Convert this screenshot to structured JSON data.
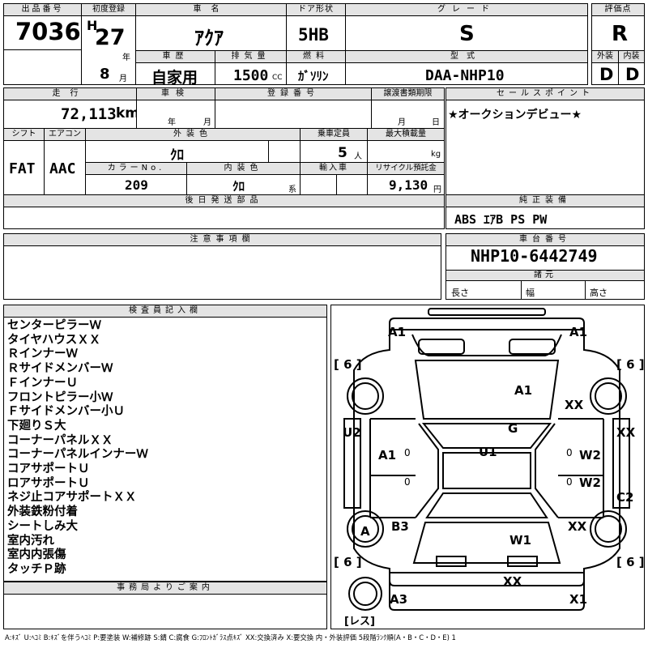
{
  "header": {
    "lot_label": "出品番号",
    "lot_number": "7036",
    "first_reg_label": "初度登録",
    "era": "H",
    "year": "27",
    "year_unit": "年",
    "month": "8",
    "month_unit": "月",
    "name_label": "車名",
    "car_name": "ｱｸｱ",
    "door_label": "ドア形状",
    "door_type": "5HB",
    "grade_label": "グレード",
    "grade": "S",
    "score_label": "評価点",
    "score": "R",
    "history_label": "車歴",
    "history": "自家用",
    "displacement_label": "排気量",
    "displacement": "1500",
    "displacement_unit": "CC",
    "fuel_label": "燃料",
    "fuel": "ｶﾞｿﾘﾝ",
    "model_label": "型式",
    "model": "DAA-NHP10",
    "exterior_label": "外装",
    "exterior_grade": "D",
    "interior_label": "内装",
    "interior_grade": "D"
  },
  "row2": {
    "mileage_label": "走行",
    "mileage": "72,113",
    "mileage_unit": "km",
    "inspection_label": "車検",
    "insp_year_unit": "年",
    "insp_month_unit": "月",
    "plate_label": "登録番号",
    "transfer_label": "譲渡書類期限",
    "transfer_month_unit": "月",
    "transfer_day_unit": "日",
    "shift_label": "シフト",
    "shift": "FAT",
    "ac_label": "エアコン",
    "ac": "AAC",
    "ext_color_label": "外装色",
    "ext_color": "ｸﾛ",
    "capacity_label": "乗車定員",
    "capacity": "5",
    "capacity_unit": "人",
    "load_label": "最大積載量",
    "load_unit": "kg",
    "color_no_label": "カラーNo.",
    "color_no": "209",
    "int_color_label": "内装色",
    "int_color": "ｸﾛ",
    "int_color_unit": "系",
    "import_label": "輸入車",
    "recycle_label": "リサイクル預託金",
    "recycle": "9,130",
    "recycle_unit": "円",
    "sales_point_label": "セールスポイント",
    "sales_point": "★オークションデビュー★",
    "later_parts_label": "後日発送部品",
    "equipment_label": "純正装備",
    "equipment": "ABS ｴｱB PS PW"
  },
  "notes": {
    "caution_label": "注意事項欄",
    "chassis_label": "車台番号",
    "chassis": "NHP10-6442749",
    "spec_label": "諸元",
    "length_label": "長さ",
    "width_label": "幅",
    "height_label": "高さ"
  },
  "inspector": {
    "label": "検査員記入欄",
    "items": [
      "センターピラーＷ",
      "タイヤハウスＸＸ",
      "ＲインナーＷ",
      "ＲサイドメンバーＷ",
      "ＦインナーＵ",
      "フロントピラー小Ｗ",
      "Ｆサイドメンバー小Ｕ",
      "下廻りＳ大",
      "コーナーパネルＸＸ",
      "コーナーパネルインナーＷ",
      "コアサポートＵ",
      "ロアサポートＵ",
      "ネジ止コアサポートＸＸ",
      "外装鉄粉付着",
      "シートしみ大",
      "室内汚れ",
      "室内内張傷",
      "タッチＰ跡"
    ],
    "office_label": "事務局よりご案内"
  },
  "diagram": {
    "marks": {
      "top_left": "A1",
      "top_right": "A1",
      "tire_fl": "6",
      "tire_fr": "6",
      "tire_rl": "6",
      "tire_rr": "6",
      "hood": "A1",
      "front_right_fender": "XX",
      "windshield": "G",
      "left_front": "U2",
      "right_front": "XX",
      "left_door": "A1",
      "roof": "U1",
      "right_door_front": "W2",
      "right_door_rear": "W2",
      "right_rear": "C2",
      "left_rear_wheel": "A",
      "left_rear": "B3",
      "rear_right_fender": "XX",
      "trunk": "W1",
      "rear_bumper": "XX",
      "bottom_left": "A3",
      "bottom_right": "X1",
      "spare": "レス",
      "door_zero_left": "0",
      "door_zero_right": "0",
      "door_zero_left2": "0",
      "door_zero_right2": "0"
    }
  },
  "legend": "A:ｷｽﾞ U:ﾍｺﾐ B:ｷｽﾞを伴うﾍｺﾐ P:要塗装 W:補修跡 S:錆 C:腐食 G:ﾌﾛﾝﾄｶﾞﾗｽ点ｷｽﾞ XX:交換済み X:要交換 内・外装評価 5段階ﾗﾝｸ順(A・B・C・D・E) 1"
}
